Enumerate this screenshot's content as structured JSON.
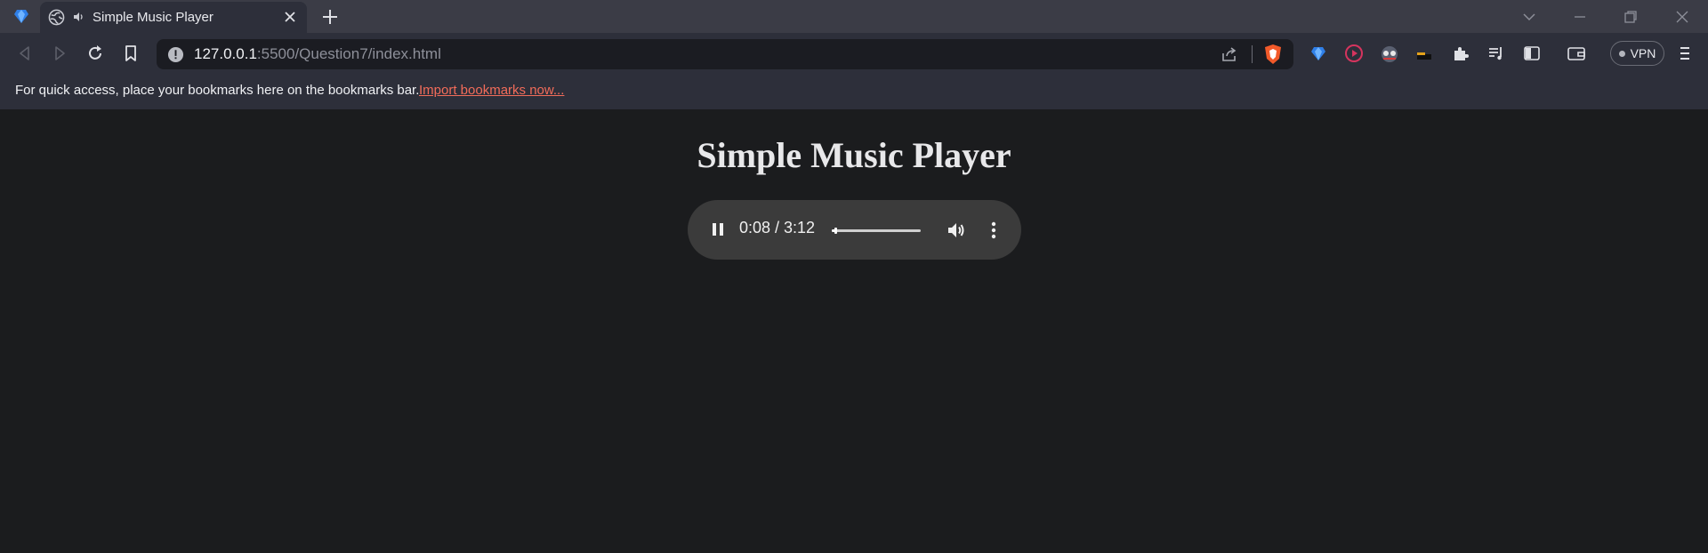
{
  "browser": {
    "tab": {
      "title": "Simple Music Player"
    },
    "address": {
      "host": "127.0.0.1",
      "rest": ":5500/Question7/index.html"
    },
    "vpn_label": "VPN",
    "bookmarks_bar": {
      "message": "For quick access, place your bookmarks here on the bookmarks bar.",
      "import_link": "Import bookmarks now..."
    },
    "accent_color": "#f26c5a"
  },
  "page": {
    "title": "Simple Music Player",
    "player": {
      "time_display": "0:08 / 3:12",
      "current_time": "0:08",
      "duration": "3:12",
      "progress_fraction": 0.042,
      "state": "playing",
      "icons": [
        "pause-icon",
        "volume-icon",
        "more-options-icon"
      ]
    }
  }
}
